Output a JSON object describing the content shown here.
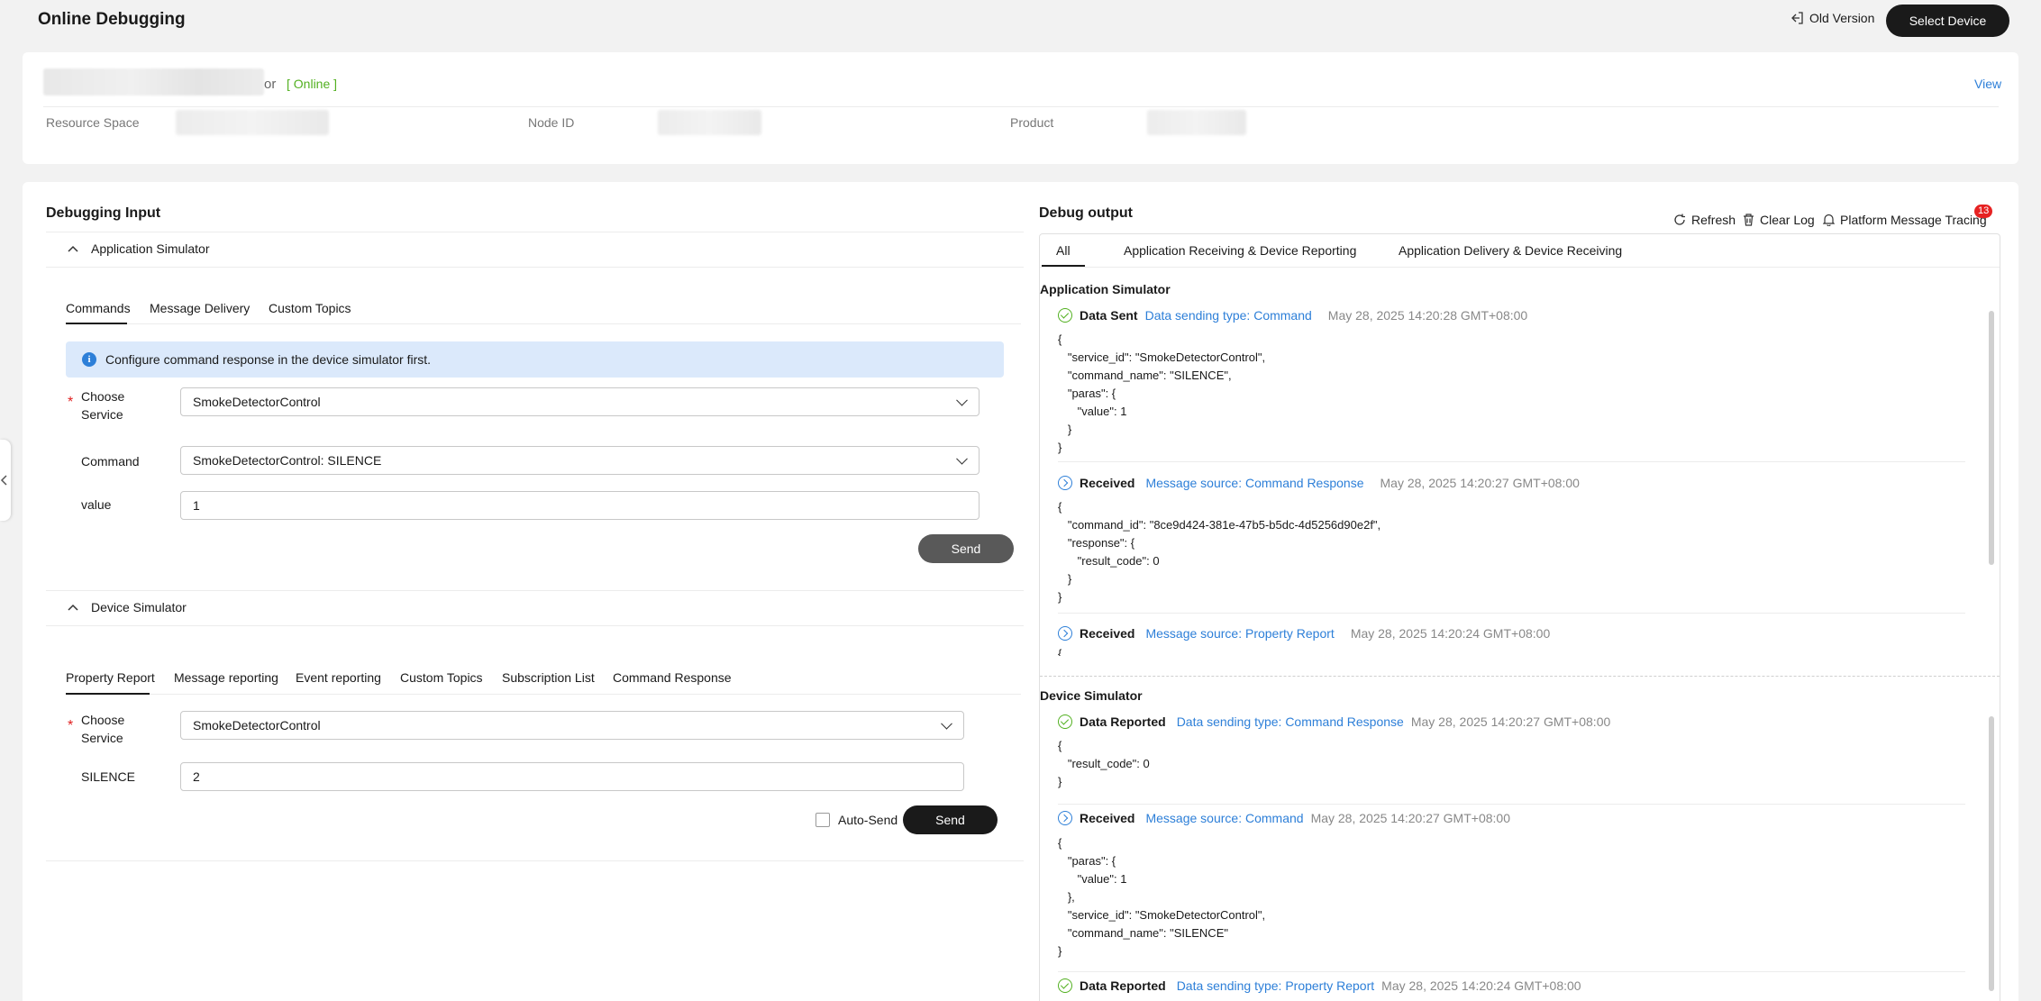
{
  "header": {
    "title": "Online Debugging",
    "old_version": "Old Version",
    "select_device": "Select Device"
  },
  "device": {
    "name_tail": "or",
    "status": "[ Online ]",
    "view": "View",
    "meta": [
      {
        "label": "Resource Space"
      },
      {
        "label": "Node ID"
      },
      {
        "label": "Product"
      }
    ]
  },
  "input": {
    "title": "Debugging Input",
    "app_sim": {
      "header": "Application Simulator",
      "tabs": [
        "Commands",
        "Message Delivery",
        "Custom Topics"
      ],
      "info": "Configure command response in the device simulator first.",
      "service_label_1": "Choose",
      "service_label_2": "Service",
      "service_value": "SmokeDetectorControl",
      "command_label": "Command",
      "command_value": "SmokeDetectorControl: SILENCE",
      "value_label": "value",
      "value_value": "1",
      "send": "Send"
    },
    "dev_sim": {
      "header": "Device Simulator",
      "tabs": [
        "Property Report",
        "Message reporting",
        "Event reporting",
        "Custom Topics",
        "Subscription List",
        "Command Response"
      ],
      "service_label_1": "Choose",
      "service_label_2": "Service",
      "service_value": "SmokeDetectorControl",
      "silence_label": "SILENCE",
      "silence_value": "2",
      "auto_send": "Auto-Send",
      "send": "Send"
    }
  },
  "output": {
    "title": "Debug output",
    "refresh": "Refresh",
    "clear_log": "Clear Log",
    "tracing": "Platform Message Tracing",
    "tracing_badge": "13",
    "tabs": [
      "All",
      "Application Receiving & Device Reporting",
      "Application Delivery & Device Receiving"
    ],
    "app_sim_title": "Application Simulator",
    "dev_sim_title": "Device Simulator",
    "app_logs": [
      {
        "type": "Data Sent",
        "source": "Data sending type: Command",
        "time": "May 28, 2025 14:20:28 GMT+08:00",
        "body": "{\n   \"service_id\": \"SmokeDetectorControl\",\n   \"command_name\": \"SILENCE\",\n   \"paras\": {\n      \"value\": 1\n   }\n}"
      },
      {
        "type": "Received",
        "source": "Message source: Command Response",
        "time": "May 28, 2025 14:20:27 GMT+08:00",
        "body": "{\n   \"command_id\": \"8ce9d424-381e-47b5-b5dc-4d5256d90e2f\",\n   \"response\": {\n      \"result_code\": 0\n   }\n}"
      },
      {
        "type": "Received",
        "source": "Message source: Property Report",
        "time": "May 28, 2025 14:20:24 GMT+08:00",
        "body": "{"
      }
    ],
    "dev_logs": [
      {
        "type": "Data Reported",
        "source": "Data sending type: Command Response",
        "time": "May 28, 2025 14:20:27 GMT+08:00",
        "body": "{\n   \"result_code\": 0\n}"
      },
      {
        "type": "Received",
        "source": "Message source: Command",
        "time": "May 28, 2025 14:20:27 GMT+08:00",
        "body": "{\n   \"paras\": {\n      \"value\": 1\n   },\n   \"service_id\": \"SmokeDetectorControl\",\n   \"command_name\": \"SILENCE\"\n}"
      },
      {
        "type": "Data Reported",
        "source": "Data sending type: Property Report",
        "time": "May 28, 2025 14:20:24 GMT+08:00",
        "body": ""
      }
    ]
  }
}
